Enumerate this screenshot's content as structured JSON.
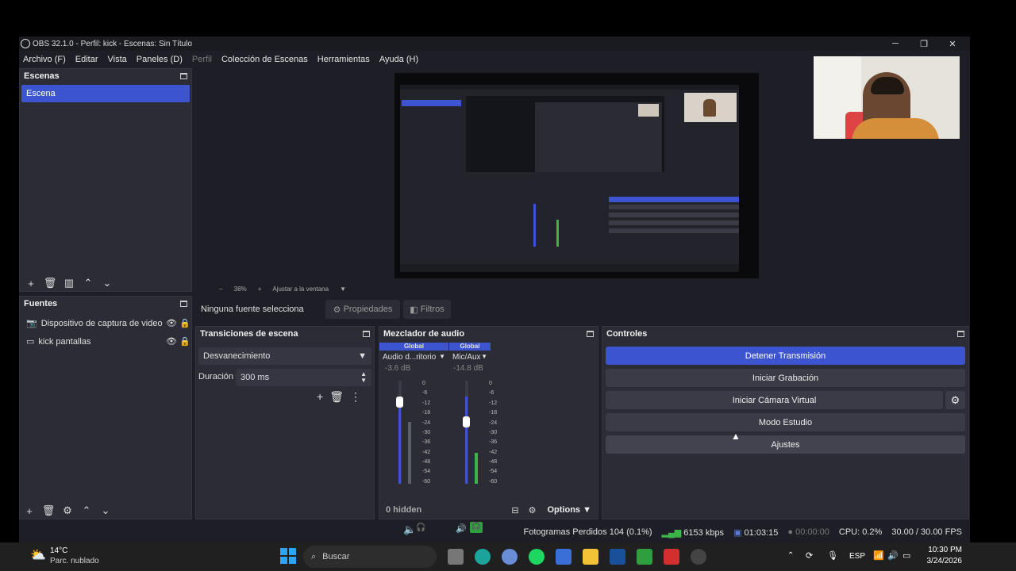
{
  "window": {
    "title": "OBS 32.1.0 - Perfil: kick - Escenas: Sin Título",
    "minimize": "─",
    "maximize": "❐",
    "close": "✕"
  },
  "menu": [
    "Archivo (F)",
    "Editar",
    "Vista",
    "Paneles (D)",
    "Perfil",
    "Colección de Escenas",
    "Herramientas",
    "Ayuda (H)"
  ],
  "scenes": {
    "title": "Escenas",
    "items": [
      "Escena"
    ]
  },
  "sources": {
    "title": "Fuentes",
    "items": [
      {
        "icon": "camera-icon",
        "label": "Dispositivo de captura de video"
      },
      {
        "icon": "monitor-icon",
        "label": "kick pantallas"
      }
    ]
  },
  "preview": {
    "zoom": "38%",
    "fit": "Ajustar a la ventana"
  },
  "source_bar": {
    "none_selected": "Ninguna fuente selecciona",
    "properties": "Propiedades",
    "filters": "Filtros"
  },
  "transitions": {
    "title": "Transiciones de escena",
    "selected": "Desvanecimiento",
    "duration_label": "Duración",
    "duration_value": "300 ms"
  },
  "mixer": {
    "title": "Mezclador de audio",
    "channels": [
      {
        "badge": "Global",
        "name": "Audio d...ritorio",
        "db": "-3.6 dB",
        "level": 0.6,
        "muted": true
      },
      {
        "badge": "Global",
        "name": "Mic/Aux",
        "db": "-14.8 dB",
        "level": 0.3,
        "muted": false
      }
    ],
    "scale": [
      "0",
      "-6",
      "-12",
      "-18",
      "-24",
      "-30",
      "-36",
      "-42",
      "-48",
      "-54",
      "-60"
    ],
    "hidden": "0 hidden",
    "options": "Options"
  },
  "controls": {
    "title": "Controles",
    "buttons": [
      "Detener Transmisión",
      "Iniciar Grabación",
      "Iniciar Cámara Virtual",
      "Modo Estudio",
      "Ajustes"
    ]
  },
  "status": {
    "dropped": "Fotogramas Perdidos 104 (0.1%)",
    "bitrate": "6153 kbps",
    "stream_time": "01:03:15",
    "rec_time": "00:00:00",
    "cpu": "CPU: 0.2%",
    "fps": "30.00 / 30.00 FPS"
  },
  "taskbar": {
    "temp": "14°C",
    "weather": "Parc. nublado",
    "search": "Buscar",
    "lang": "ESP",
    "time": "10:30 PM",
    "date": "3/24/2026"
  },
  "colors": {
    "accent": "#3c54d0",
    "bg": "#1e1f26",
    "panel": "#2b2c35"
  }
}
